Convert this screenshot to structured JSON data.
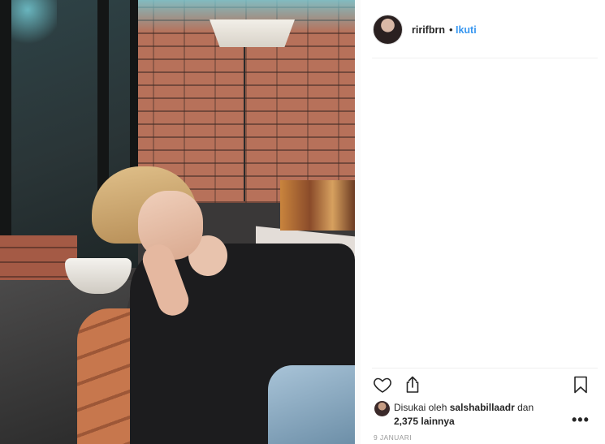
{
  "post": {
    "author": {
      "username": "ririfbrn",
      "separator": "•",
      "follow_label": "Ikuti"
    },
    "likes": {
      "prefix": "Disukai oleh",
      "liker": "salshabillaadr",
      "conjunction": "dan",
      "others": "2,375 lainnya"
    },
    "more_label": "•••",
    "date": "9 JANUARI"
  },
  "icons": {
    "like": "heart-icon",
    "share": "share-icon",
    "save": "bookmark-icon"
  },
  "colors": {
    "link": "#3897f0",
    "text": "#262626",
    "muted": "#999999",
    "divider": "#efefef"
  }
}
